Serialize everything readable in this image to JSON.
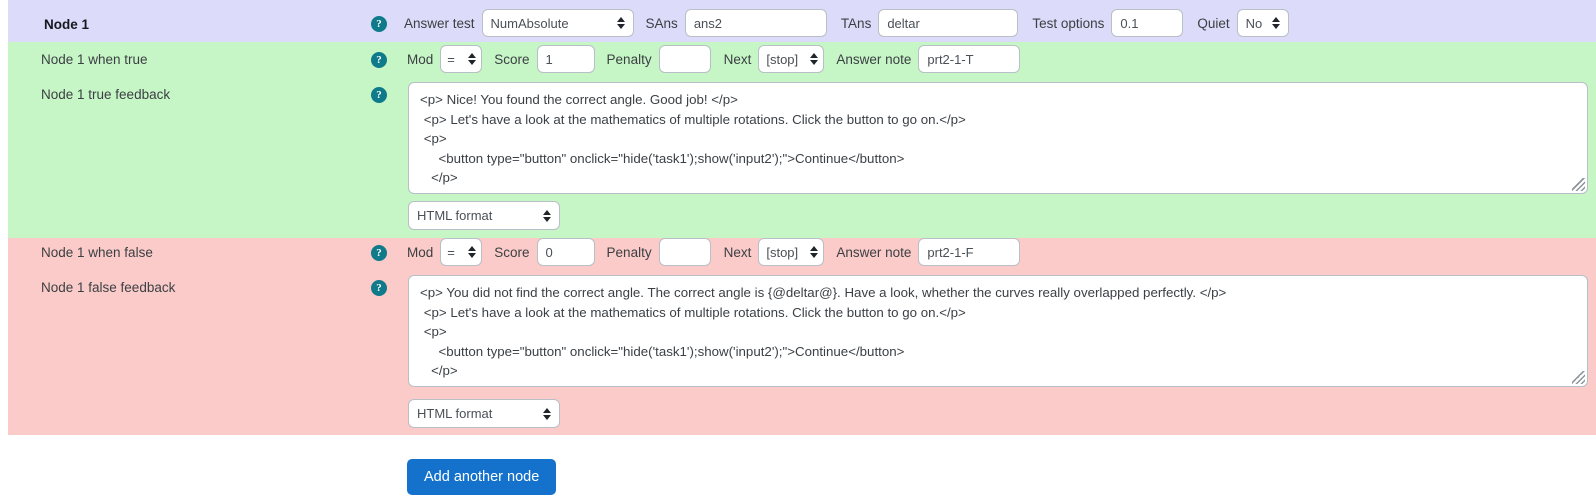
{
  "icons": {
    "help": "?"
  },
  "colors": {
    "node_band": "#dcdcfa",
    "true_band": "#c6f6c6",
    "false_band": "#fbcbc9",
    "help_icon": "#0f7b8a",
    "primary_button": "#1472cc"
  },
  "node_row": {
    "title": "Node 1",
    "help_label": "?",
    "answer_test_label": "Answer test",
    "answer_test_value": "NumAbsolute",
    "sans_label": "SAns",
    "sans_value": "ans2",
    "tans_label": "TAns",
    "tans_value": "deltar",
    "test_options_label": "Test options",
    "test_options_value": "0.1",
    "quiet_label": "Quiet",
    "quiet_value": "No"
  },
  "true_row": {
    "label": "Node 1 when true",
    "help_label": "?",
    "mod_label": "Mod",
    "mod_value": "=",
    "score_label": "Score",
    "score_value": "1",
    "penalty_label": "Penalty",
    "penalty_value": "",
    "next_label": "Next",
    "next_value": "[stop]",
    "answer_note_label": "Answer note",
    "answer_note_value": "prt2-1-T"
  },
  "true_feedback": {
    "label": "Node 1 true feedback",
    "help_label": "?",
    "text": "<p> Nice! You found the correct angle. Good job! </p>\n <p> Let's have a look at the mathematics of multiple rotations. Click the button to go on.</p>\n <p>\n     <button type=\"button\" onclick=\"hide('task1');show('input2');\">Continue</button>\n   </p>",
    "format_value": "HTML format"
  },
  "false_row": {
    "label": "Node 1 when false",
    "help_label": "?",
    "mod_label": "Mod",
    "mod_value": "=",
    "score_label": "Score",
    "score_value": "0",
    "penalty_label": "Penalty",
    "penalty_value": "",
    "next_label": "Next",
    "next_value": "[stop]",
    "answer_note_label": "Answer note",
    "answer_note_value": "prt2-1-F"
  },
  "false_feedback": {
    "label": "Node 1 false feedback",
    "help_label": "?",
    "text": "<p> You did not find the correct angle. The correct angle is {@deltar@}. Have a look, whether the curves really overlapped perfectly. </p>\n <p> Let's have a look at the mathematics of multiple rotations. Click the button to go on.</p>\n <p>\n     <button type=\"button\" onclick=\"hide('task1');show('input2');\">Continue</button>\n   </p>",
    "format_value": "HTML format"
  },
  "footer": {
    "add_node_label": "Add another node"
  }
}
